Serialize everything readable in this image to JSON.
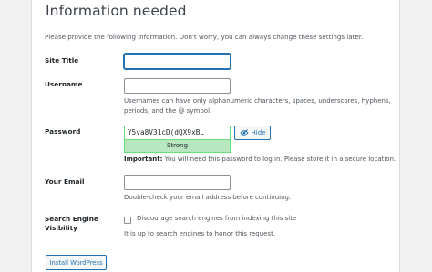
{
  "heading": "Information needed",
  "intro": "Please provide the following information. Don't worry, you can always change these settings later.",
  "fields": {
    "site_title": {
      "label": "Site Title",
      "value": ""
    },
    "username": {
      "label": "Username",
      "value": "",
      "help_line1": "Usernames can have only alphanumeric characters, spaces, underscores, hyphens,",
      "help_line2": "periods, and the @ symbol."
    },
    "password": {
      "label": "Password",
      "value": "Y5va8V31cD(dQX9xBL",
      "strength": "Strong",
      "toggle_label": "Hide",
      "important_prefix": "Important:",
      "important_text": "You will need this password to log in. Please store it in a secure location."
    },
    "email": {
      "label": "Your Email",
      "value": "",
      "help": "Double-check your email address before continuing."
    },
    "search_visibility": {
      "label_line1": "Search Engine",
      "label_line2": "Visibility",
      "checkbox_label": "Discourage search engines from indexing this site",
      "checked": false,
      "help": "It is up to search engines to honor this request."
    }
  },
  "install_button": "Install WordPress",
  "colors": {
    "accent": "#2271b1",
    "strength_bg": "#b8e6bf",
    "strength_border": "#68de7c"
  },
  "icons": {
    "hide_toggle": "eye-slash-icon"
  }
}
